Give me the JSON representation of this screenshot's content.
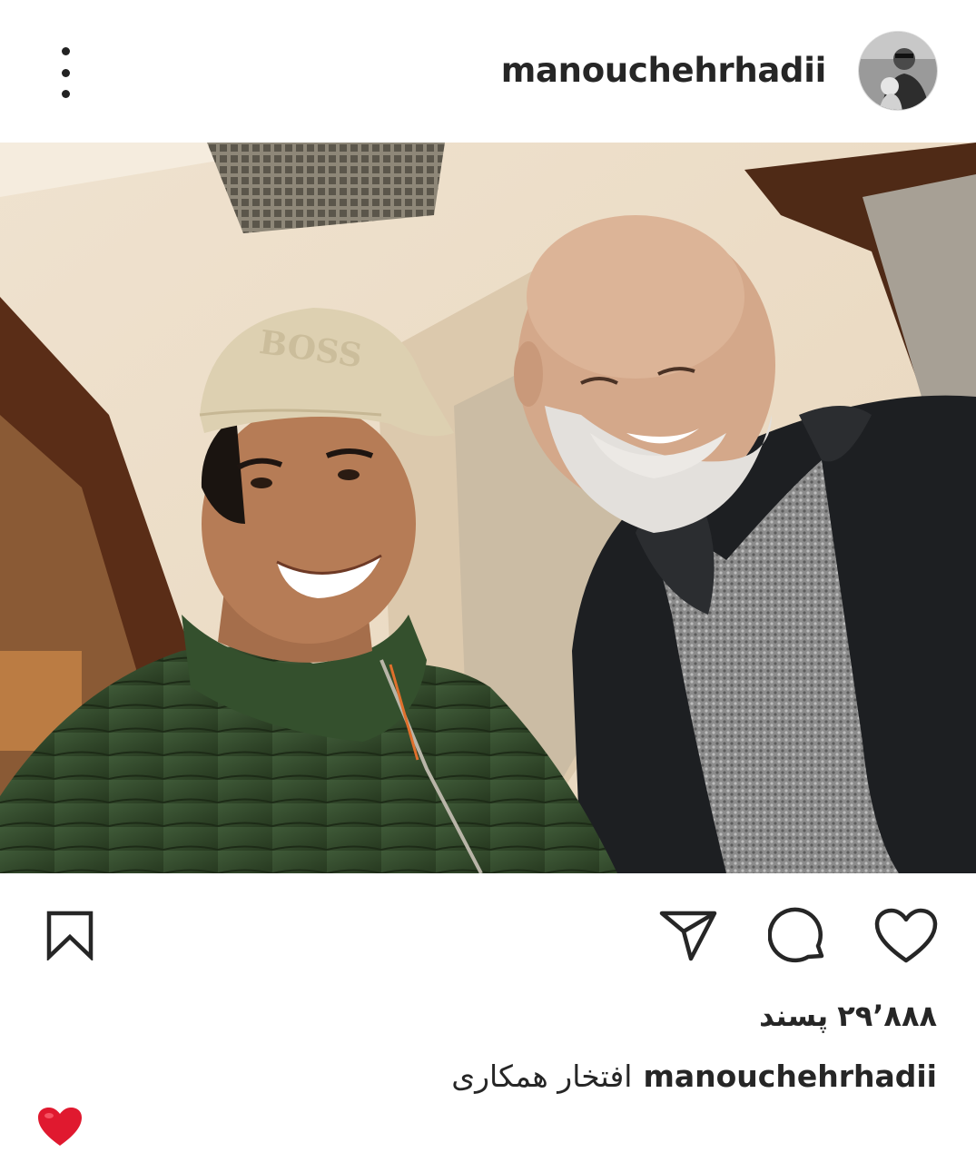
{
  "post": {
    "username": "manouchehrhadii",
    "likes_count": "۲۹٬۸۸۸",
    "likes_label": "پسند",
    "caption_username": "manouchehrhadii",
    "caption_text": "افتخار همکاری",
    "comment_emoji": "red-heart",
    "image_alt": "Selfie photo of two smiling men"
  },
  "icons": {
    "more": "more-vertical-icon",
    "save": "bookmark-icon",
    "share": "send-icon",
    "comment": "comment-icon",
    "like": "heart-outline-icon"
  },
  "colors": {
    "text": "#262626",
    "background": "#ffffff",
    "heart": "#e0192f"
  }
}
